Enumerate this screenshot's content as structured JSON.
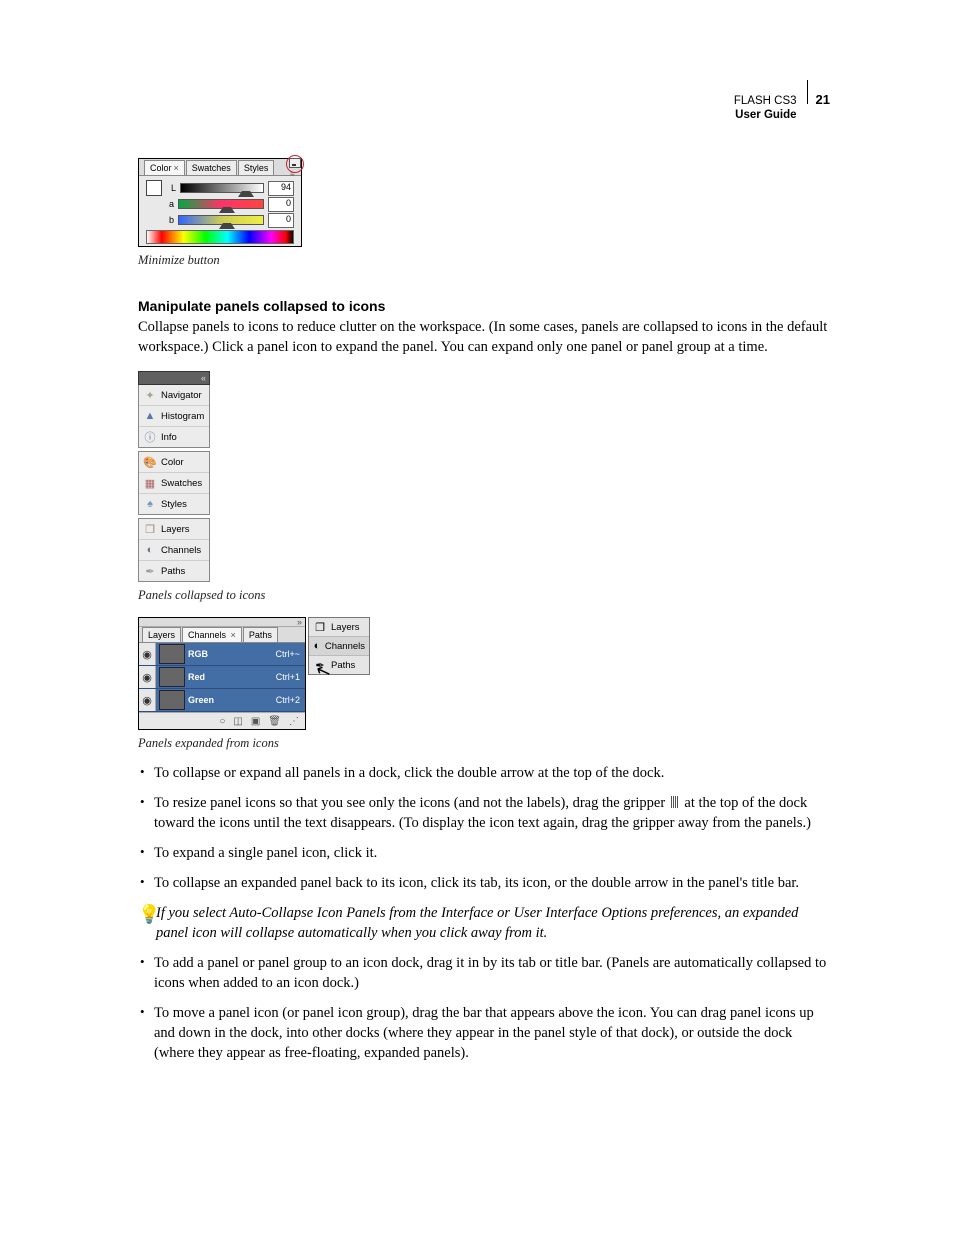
{
  "header": {
    "title": "FLASH CS3",
    "subtitle": "User Guide",
    "page_number": "21"
  },
  "fig1": {
    "tabs": [
      "Color",
      "Swatches",
      "Styles"
    ],
    "active_tab_index": 0,
    "sliders": [
      {
        "label": "L",
        "value": "94"
      },
      {
        "label": "a",
        "value": "0"
      },
      {
        "label": "b",
        "value": "0"
      }
    ],
    "caption": "Minimize button"
  },
  "section": {
    "heading": "Manipulate panels collapsed to icons",
    "para": "Collapse panels to icons to reduce clutter on the workspace. (In some cases, panels are collapsed to icons in the default workspace.) Click a panel icon to expand the panel. You can expand only one panel or panel group at a time."
  },
  "dock": {
    "groups": [
      [
        "Navigator",
        "Histogram",
        "Info"
      ],
      [
        "Color",
        "Swatches",
        "Styles"
      ],
      [
        "Layers",
        "Channels",
        "Paths"
      ]
    ],
    "caption": "Panels collapsed to icons"
  },
  "expanded": {
    "tabs": [
      "Layers",
      "Channels",
      "Paths"
    ],
    "active_tab_index": 1,
    "rows": [
      {
        "name": "RGB",
        "shortcut": "Ctrl+~"
      },
      {
        "name": "Red",
        "shortcut": "Ctrl+1"
      },
      {
        "name": "Green",
        "shortcut": "Ctrl+2"
      }
    ],
    "side_items": [
      "Layers",
      "Channels",
      "Paths"
    ],
    "caption": "Panels expanded from icons"
  },
  "bullets": {
    "b1": "To collapse or expand all panels in a dock, click the double arrow at the top of the dock.",
    "b2a": "To resize panel icons so that you see only the icons (and not the labels), drag the gripper ",
    "b2b": " at the top of the dock toward the icons until the text disappears. (To display the icon text again, drag the gripper away from the panels.)",
    "b3": "To expand a single panel icon, click it.",
    "b4": "To collapse an expanded panel back to its icon, click its tab, its icon, or the double arrow in the panel's title bar.",
    "tip": "If you select Auto-Collapse Icon Panels from the Interface or User Interface Options preferences, an expanded panel icon will collapse automatically when you click away from it.",
    "b5": "To add a panel or panel group to an icon dock, drag it in by its tab or title bar. (Panels are automatically collapsed to icons when added to an icon dock.)",
    "b6": "To move a panel icon (or panel icon group), drag the bar that appears above the icon. You can drag panel icons up and down in the dock, into other docks (where they appear in the panel style of that dock), or outside the dock (where they appear as free-floating, expanded panels)."
  }
}
